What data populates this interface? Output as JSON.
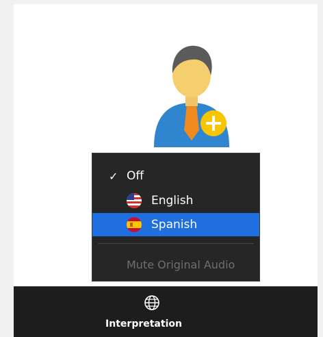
{
  "menu": {
    "items": [
      {
        "label": "Off",
        "checked": true
      },
      {
        "label": "English",
        "flag": "us-flag-icon"
      },
      {
        "label": "Spanish",
        "flag": "spain-flag-icon",
        "highlighted": true
      }
    ],
    "mute_label": "Mute Original Audio"
  },
  "toolbar": {
    "interpretation_label": "Interpretation",
    "icon": "globe-icon"
  },
  "colors": {
    "highlight": "#1f6fe0",
    "menu_bg": "#262626",
    "toolbar_bg": "#1d1d1d",
    "add_badge": "#f7c600",
    "avatar_blue": "#2f86cf"
  }
}
